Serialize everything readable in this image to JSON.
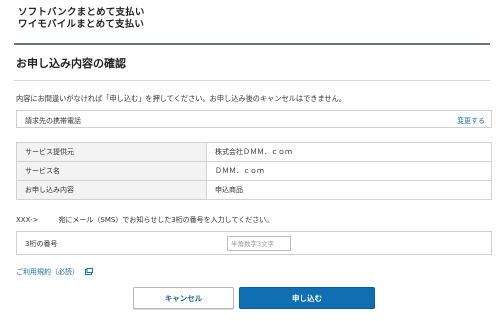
{
  "header": {
    "line1": "ソフトバンクまとめて支払い",
    "line2": "ワイモバイルまとめて支払い"
  },
  "page_title": "お申し込み内容の確認",
  "intro_text": "内容にお間違いがなければ「申し込む」を押してください。お申し込み後のキャンセルはできません。",
  "billing_phone": {
    "label": "請求先の携帯電話",
    "change_label": "変更する"
  },
  "details": [
    {
      "label": "サービス提供元",
      "value": "株式会社ＤＭＭ．ｃｏｍ"
    },
    {
      "label": "サービス名",
      "value": "ＤＭＭ．ｃｏｍ"
    },
    {
      "label": "お申し込み内容",
      "value": "申込商品"
    }
  ],
  "otp_note": {
    "prefix": "XXX->",
    "text": "宛にメール（SMS）でお知らせした3桁の番号を入力してください。"
  },
  "code_field": {
    "label": "3桁の番号",
    "placeholder": "半角数字3文字",
    "value": ""
  },
  "terms_link": "ご利用規約（必読）",
  "buttons": {
    "cancel": "キャンセル",
    "submit": "申し込む"
  },
  "colors": {
    "link": "#1a6fb5",
    "primary_button": "#0f6fb2",
    "table_label_bg": "#f3f3f3"
  }
}
